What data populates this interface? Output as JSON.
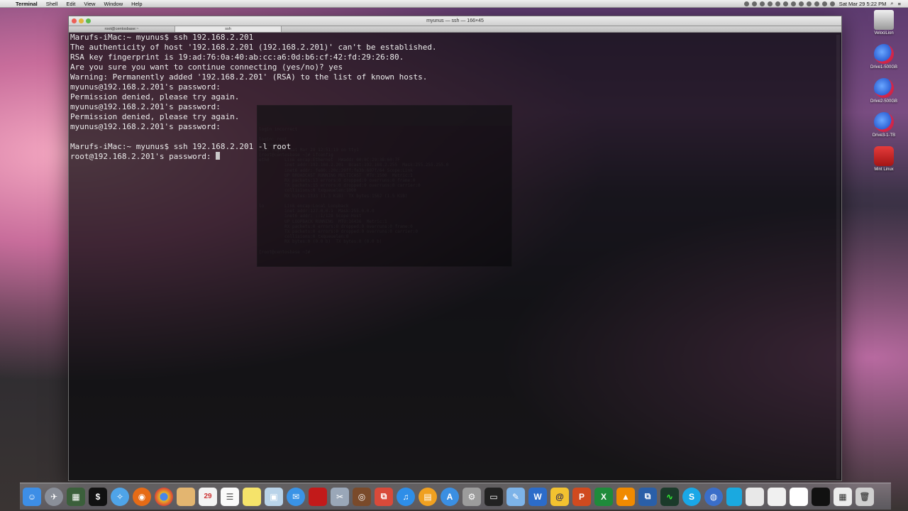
{
  "menubar": {
    "apple": "",
    "app_name": "Terminal",
    "menus": [
      "Shell",
      "Edit",
      "View",
      "Window",
      "Help"
    ],
    "clock": "Sat Mar 29  5:22 PM"
  },
  "window": {
    "title": "myunus — ssh — 166×45",
    "tabs": [
      "root@centosbase:~",
      "ssh"
    ]
  },
  "terminal_lines": [
    "Marufs-iMac:~ myunus$ ssh 192.168.2.201",
    "The authenticity of host '192.168.2.201 (192.168.2.201)' can't be established.",
    "RSA key fingerprint is 19:ad:76:0a:40:ab:cc:a6:0d:b6:cf:42:fd:29:26:80.",
    "Are you sure you want to continue connecting (yes/no)? yes",
    "Warning: Permanently added '192.168.2.201' (RSA) to the list of known hosts.",
    "myunus@192.168.2.201's password:",
    "Permission denied, please try again.",
    "myunus@192.168.2.201's password:",
    "Permission denied, please try again.",
    "myunus@192.168.2.201's password:",
    "",
    "Marufs-iMac:~ myunus$ ssh 192.168.2.201 -l root"
  ],
  "prompt_line": "root@192.168.2.201's password: ",
  "desktop_icons": [
    {
      "label": "VelociLion",
      "kind": "hd"
    },
    {
      "label": "Drive1-500GB",
      "kind": "drv"
    },
    {
      "label": "Drive2-500GB",
      "kind": "drv"
    },
    {
      "label": "Drive3-1-TB",
      "kind": "drv"
    },
    {
      "label": "Mint Linux",
      "kind": "par"
    }
  ],
  "dock": {
    "date_icon_day": "29",
    "colors": {
      "finder": "#3d8ee6",
      "terminal": "#111111",
      "firefox": "#e66b16",
      "chrome": "#e8b923",
      "itunes": "#2e8ee8",
      "word": "#2c6cc9",
      "excel": "#1f8b3b",
      "powerpoint": "#d04a1f",
      "vlc": "#f08a00",
      "skype": "#19a7e7"
    }
  }
}
